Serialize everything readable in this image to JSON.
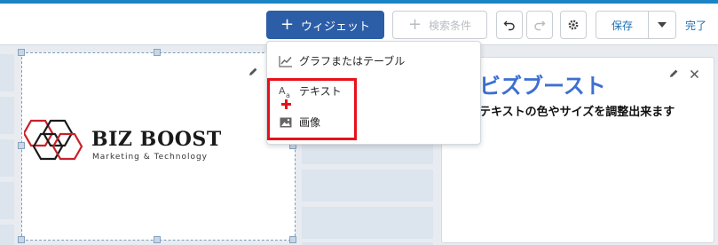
{
  "toolbar": {
    "widget_label": "ウィジェット",
    "filter_label": "検索条件",
    "save_label": "保存",
    "done_label": "完了"
  },
  "add_menu": {
    "items": [
      {
        "label": "グラフまたはテーブル",
        "icon": "line-chart-icon"
      },
      {
        "label": "テキスト",
        "icon": "text-icon"
      },
      {
        "label": "画像",
        "icon": "image-icon"
      }
    ]
  },
  "image_widget": {
    "logo_title": "BIZ BOOST",
    "logo_tagline": "Marketing & Technology"
  },
  "text_widget": {
    "title": "ビズブースト",
    "subtitle": "テキストの色やサイズを調整出来ます"
  },
  "colors": {
    "primary": "#2c5ea8",
    "accent_line": "#1b84c4",
    "highlight": "#e8101a",
    "text_widget_title": "#3d6fd1",
    "logo_hex_red": "#c8202a"
  }
}
